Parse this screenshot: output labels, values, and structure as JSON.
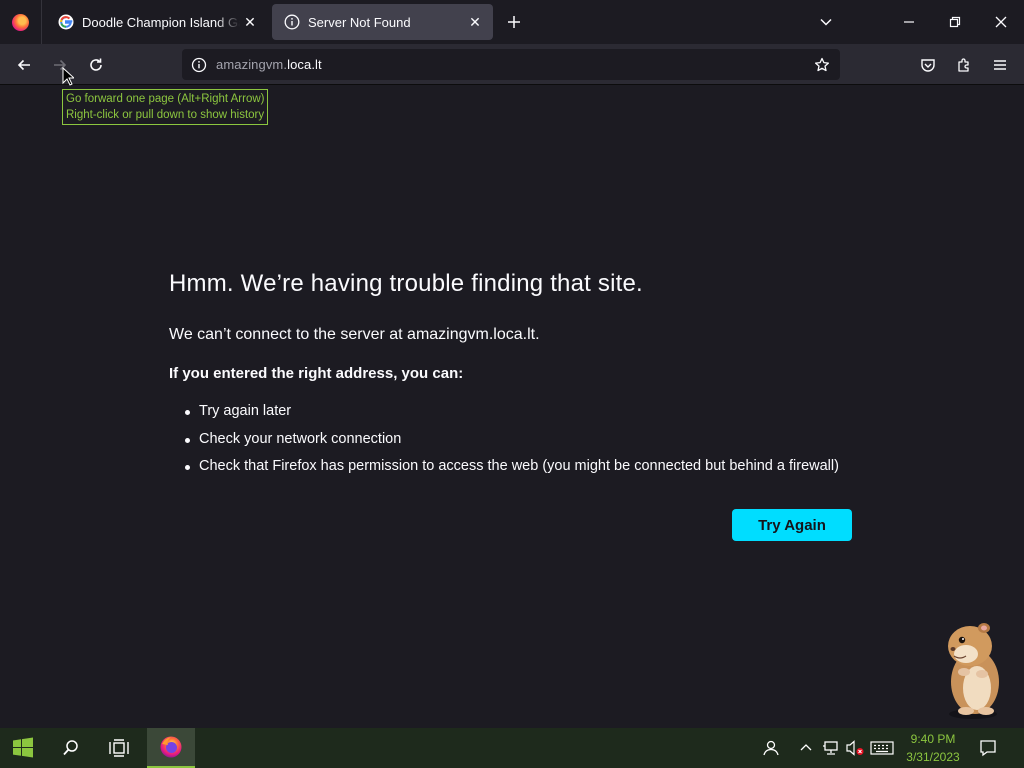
{
  "browser": {
    "tabs": [
      {
        "title": "Doodle Champion Island Games",
        "favicon": "google-g-icon",
        "active": false
      },
      {
        "title": "Server Not Found",
        "favicon": "info-icon",
        "active": true
      }
    ],
    "url_subdomain": "amazingvm.",
    "url_domain": "loca.lt",
    "tooltip_line1": "Go forward one page (Alt+Right Arrow)",
    "tooltip_line2": "Right-click or pull down to show history"
  },
  "error_page": {
    "title": "Hmm. We’re having trouble finding that site.",
    "description": "We can’t connect to the server at amazingvm.loca.lt.",
    "subtitle": "If you entered the right address, you can:",
    "suggestions": [
      "Try again later",
      "Check your network connection",
      "Check that Firefox has permission to access the web (you might be connected but behind a firewall)"
    ],
    "button_label": "Try Again"
  },
  "taskbar": {
    "time": "9:40 PM",
    "date": "3/31/2023"
  },
  "colors": {
    "accent": "#00ddff",
    "page_bg": "#1c1b22",
    "toolbar_bg": "#2b2a33",
    "taskbar_accent": "#8cc63f"
  }
}
